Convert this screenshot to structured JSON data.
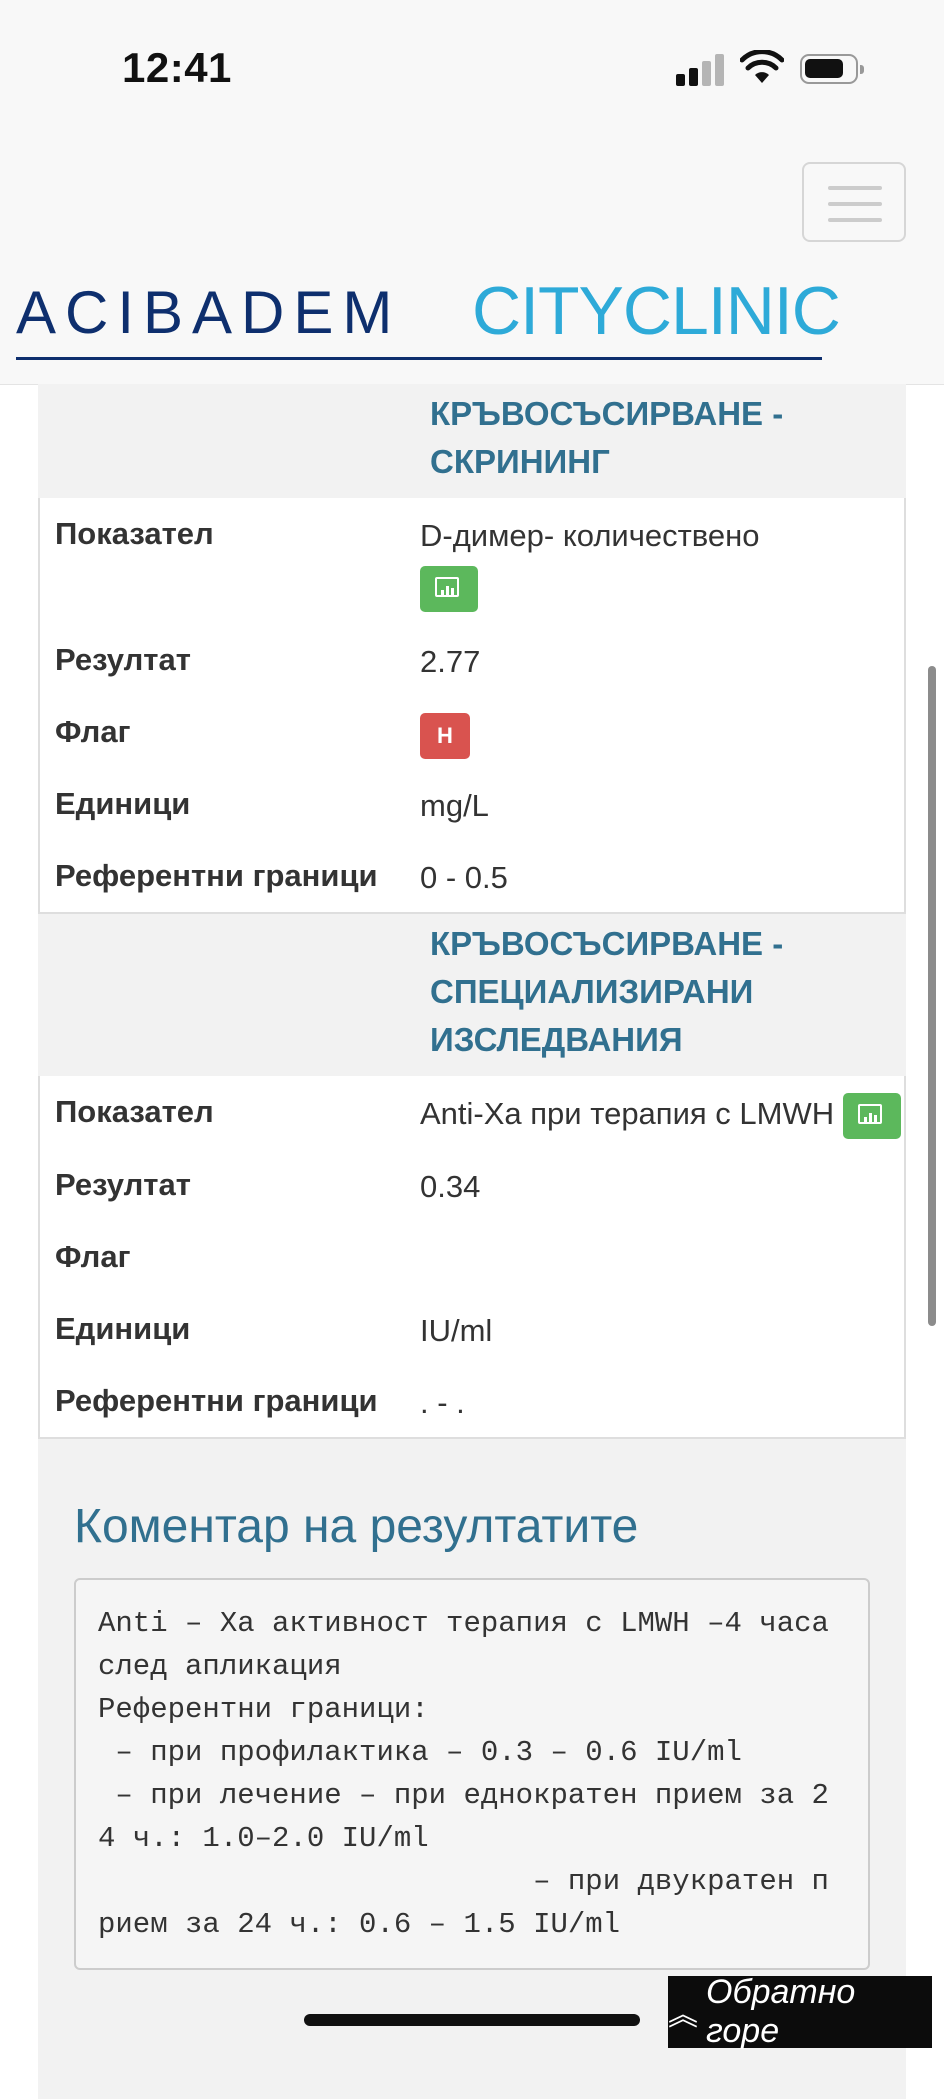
{
  "status": {
    "time": "12:41"
  },
  "header": {
    "logo_left": "ACIBADEM",
    "logo_right": "CITYCLINIC",
    "colors": {
      "logo_navy": "#0e2f6e",
      "logo_blue": "#2eaad8"
    }
  },
  "sections": [
    {
      "title": "КРЪВОСЪСИРВАНЕ - СКРИНИНГ",
      "rows": {
        "indicator": {
          "label": "Показател",
          "value": "D-димер- количествено"
        },
        "result": {
          "label": "Резултат",
          "value": "2.77"
        },
        "flag": {
          "label": "Флаг",
          "value": "H"
        },
        "units": {
          "label": "Единици",
          "value": "mg/L"
        },
        "reference": {
          "label": "Референтни граници",
          "value": "0 - 0.5"
        }
      }
    },
    {
      "title": "КРЪВОСЪСИРВАНЕ - СПЕЦИАЛИЗИРАНИ ИЗСЛЕДВАНИЯ",
      "rows": {
        "indicator": {
          "label": "Показател",
          "value": "Anti-Xa при терапия с LMWH"
        },
        "result": {
          "label": "Резултат",
          "value": "0.34"
        },
        "flag": {
          "label": "Флаг",
          "value": ""
        },
        "units": {
          "label": "Единици",
          "value": "IU/ml"
        },
        "reference": {
          "label": "Референтни граници",
          "value": ". - ."
        }
      }
    }
  ],
  "comment": {
    "title": "Коментар на резултатите",
    "text": "Anti – Xa активност терапия с LMWH –4 часа след апликация\nРеферентни граници:\n – при профилактика – 0.3 – 0.6 IU/ml\n – при лечение – при еднократен прием за 24 ч.: 1.0–2.0 IU/ml\n                         – при двукратен прием за 24 ч.: 0.6 – 1.5 IU/ml"
  },
  "back_to_top": {
    "label": "Обратно горе"
  },
  "colors": {
    "section_title": "#31708f",
    "flag_high": "#d9534f",
    "chart_button": "#5cb85c"
  }
}
